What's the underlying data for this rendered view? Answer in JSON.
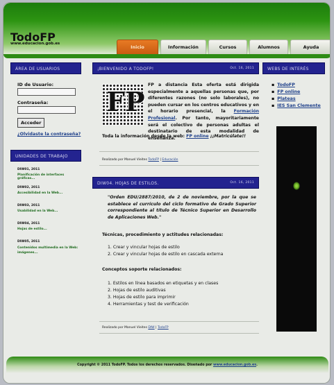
{
  "site": {
    "title": "TodoFP",
    "url": "www.educacion.gob.es"
  },
  "nav": {
    "tabs": [
      {
        "label": "Inicio",
        "active": true
      },
      {
        "label": "Información",
        "active": false
      },
      {
        "label": "Cursos",
        "active": false
      },
      {
        "label": "Alumnos",
        "active": false
      },
      {
        "label": "Ayuda",
        "active": false
      }
    ]
  },
  "user_area": {
    "heading": "ÁREA DE USUARIOS",
    "id_label": "ID de Usuario:",
    "id_value": "",
    "password_label": "Contraseña:",
    "password_value": "",
    "submit_label": "Acceder",
    "forgot_label": "¿Olvidaste la contraseña?"
  },
  "work_units": {
    "heading": "UNIDADES DE TRABAJO",
    "items": [
      {
        "date": "DIW01, 2011",
        "title": "Planificación de interfaces gráficas..."
      },
      {
        "date": "DIW02, 2011",
        "title": "Accesibilidad en la Web..."
      },
      {
        "date": "DIW03, 2011",
        "title": "Usabilidad en la Web..."
      },
      {
        "date": "DIW04, 2011",
        "title": "Hojas de estilo..."
      },
      {
        "date": "DIW05, 2011",
        "title": "Contenidos multimedia en la Web: imágenes..."
      }
    ]
  },
  "links_box": {
    "heading": "WEBS DE INTERÉS",
    "items": [
      "TodoFP",
      "FP online",
      "Plateas",
      "IES San Clemente"
    ]
  },
  "post1": {
    "heading": "¡BIENVENIDO A TODOFP!",
    "date": "Oct. 16, 2011",
    "image_label": "FP",
    "body_before_link": "FP a distancia Esta oferta está dirigida especialmente a aquellas personas que, por diferentes razones (no solo laborales), no pueden cursar en los centros educativos y en el horario presencial, la ",
    "link": "Formación Profesional",
    "body_after_link": ". Por tanto, mayoritariamente será el colectivo de personas adultas el destinatario de esta modalidad de enseñanza.",
    "info_prefix": "Toda la información desde la web: ",
    "info_link": "FP online",
    "info_suffix": " ¡¡Matricúlate!!",
    "meta_prefix": "Realizado por Manuel Vieites ",
    "meta_link1": "TodoFP",
    "meta_sep": " | ",
    "meta_link2": "Educación"
  },
  "post2": {
    "heading": "DIW04. HOJAS DE ESTILOS.",
    "date": "Oct. 16, 2011",
    "quote": "\"Orden EDU/2887/2010, de 2 de noviembre, por la que se establece el currículo del ciclo formativo de Grado Superior correspondiente al título de Técnico Superior en Desarrollo de Aplicaciones Web.\"",
    "techniques_heading": "Técnicas, procedimiento y actitudes relacionadas:",
    "techniques": [
      "1.  Crear y vincular hojas de estilo",
      "2.  Crear y vincular hojas de estilo en cascada externa"
    ],
    "concepts_heading": "Conceptos soporte relacionados:",
    "concepts": [
      "1.  Estilos en línea basados en etiquetas y en clases",
      "2.  Hojas de estilo auditivas",
      "3.  Hojas de estilo para imprimir",
      "4.  Herramientas y test de verificación"
    ],
    "meta_prefix": "Realizado por Manuel Vieites ",
    "meta_link1": "DIW",
    "meta_sep": " | ",
    "meta_link2": "TodoFP"
  },
  "footer": {
    "text": "Copyright © 2011 TodoFP. Todos los derechos reservados. Diseñado por ",
    "link": "www.educacion.gob.es",
    "suffix": "."
  }
}
